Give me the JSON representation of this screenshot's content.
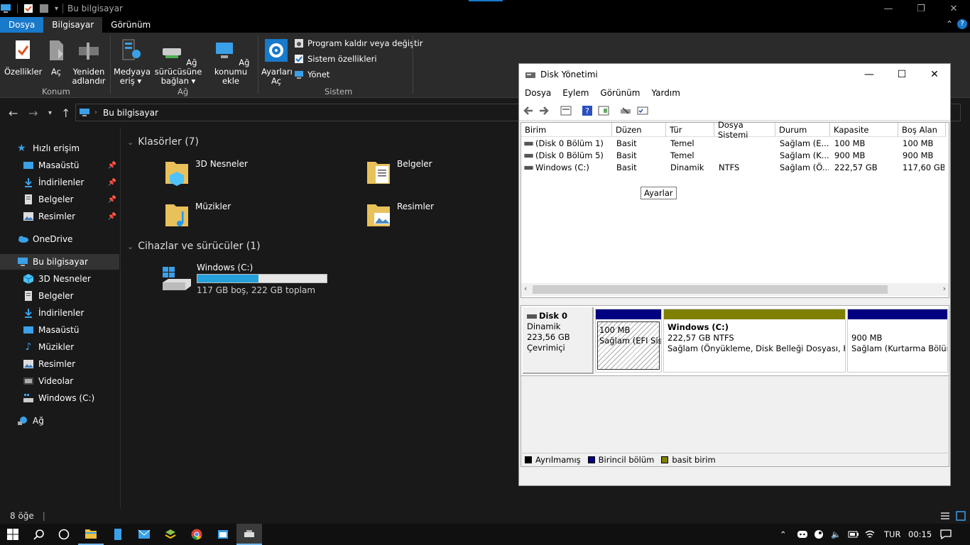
{
  "explorer": {
    "title": "Bu bilgisayar",
    "tabs": [
      "Dosya",
      "Bilgisayar",
      "Görünüm"
    ],
    "ribbon": {
      "buttons": {
        "ozellikler": "Özellikler",
        "ac": "Aç",
        "yeniden_adlandir": "Yeniden adlandır",
        "medyaya_eris": "Medyaya eriş",
        "ag_surucusune_baglan": "Ağ sürücüsüne bağlan",
        "ag_konumu_ekle": "Ağ konumu ekle",
        "ayarlari_ac": "Ayarları Aç",
        "program_kaldir": "Program kaldır veya değiştir",
        "sistem_ozellikleri": "Sistem özellikleri",
        "yonet": "Yönet"
      },
      "groups": {
        "konum": "Konum",
        "ag": "Ağ",
        "sistem": "Sistem"
      }
    },
    "address": "Bu bilgisayar",
    "sidebar": [
      {
        "label": "Hızlı erişim",
        "icon": "star-icon"
      },
      {
        "label": "Masaüstü",
        "icon": "desktop-icon",
        "pinned": true
      },
      {
        "label": "İndirilenler",
        "icon": "download-icon",
        "pinned": true
      },
      {
        "label": "Belgeler",
        "icon": "document-icon",
        "pinned": true
      },
      {
        "label": "Resimler",
        "icon": "picture-icon",
        "pinned": true
      },
      {
        "label": "OneDrive",
        "icon": "cloud-icon"
      },
      {
        "label": "Bu bilgisayar",
        "icon": "computer-icon"
      },
      {
        "label": "3D Nesneler",
        "icon": "cube-icon"
      },
      {
        "label": "Belgeler",
        "icon": "document-icon"
      },
      {
        "label": "İndirilenler",
        "icon": "download-icon"
      },
      {
        "label": "Masaüstü",
        "icon": "desktop-icon"
      },
      {
        "label": "Müzikler",
        "icon": "music-icon"
      },
      {
        "label": "Resimler",
        "icon": "picture-icon"
      },
      {
        "label": "Videolar",
        "icon": "video-icon"
      },
      {
        "label": "Windows (C:)",
        "icon": "drive-icon"
      },
      {
        "label": "Ağ",
        "icon": "network-icon"
      }
    ],
    "sections": {
      "folders": "Klasörler (7)",
      "devices": "Cihazlar ve sürücüler (1)"
    },
    "folders": [
      "3D Nesneler",
      "Belgeler",
      "Müzikler",
      "Resimler"
    ],
    "drive": {
      "name": "Windows (C:)",
      "detail": "117 GB boş, 222 GB toplam",
      "used_fraction": 0.47
    },
    "status": "8 öğe"
  },
  "disk_manager": {
    "title": "Disk Yönetimi",
    "menu": [
      "Dosya",
      "Eylem",
      "Görünüm",
      "Yardım"
    ],
    "tooltip": "Ayarlar",
    "columns": [
      "Birim",
      "Düzen",
      "Tür",
      "Dosya Sistemi",
      "Durum",
      "Kapasite",
      "Boş Alan"
    ],
    "rows": [
      [
        "(Disk 0 Bölüm 1)",
        "Basit",
        "Temel",
        "",
        "Sağlam (E...",
        "100 MB",
        "100 MB"
      ],
      [
        "(Disk 0 Bölüm 5)",
        "Basit",
        "Temel",
        "",
        "Sağlam (K...",
        "900 MB",
        "900 MB"
      ],
      [
        "Windows (C:)",
        "Basit",
        "Dinamik",
        "NTFS",
        "Sağlam (Ö...",
        "222,57 GB",
        "117,60 GB"
      ]
    ],
    "disk": {
      "name": "Disk 0",
      "type": "Dinamik",
      "size": "223,56 GB",
      "state": "Çevrimiçi"
    },
    "partitions": [
      {
        "line1": "",
        "line2": "100 MB",
        "line3": "Sağlam (EFI Sistem"
      },
      {
        "line1": "Windows  (C:)",
        "line2": "222,57 GB NTFS",
        "line3": "Sağlam (Önyükleme, Disk Belleği Dosyası, Kilit"
      },
      {
        "line1": "",
        "line2": "900 MB",
        "line3": "Sağlam (Kurtarma Bölüm"
      }
    ],
    "legend": [
      "Ayrılmamış",
      "Birincil bölüm",
      "basit birim"
    ],
    "colors": {
      "unallocated": "#000000",
      "primary": "#000080",
      "simple": "#808000"
    }
  },
  "taskbar": {
    "lang": "TUR",
    "time": "00:15"
  }
}
